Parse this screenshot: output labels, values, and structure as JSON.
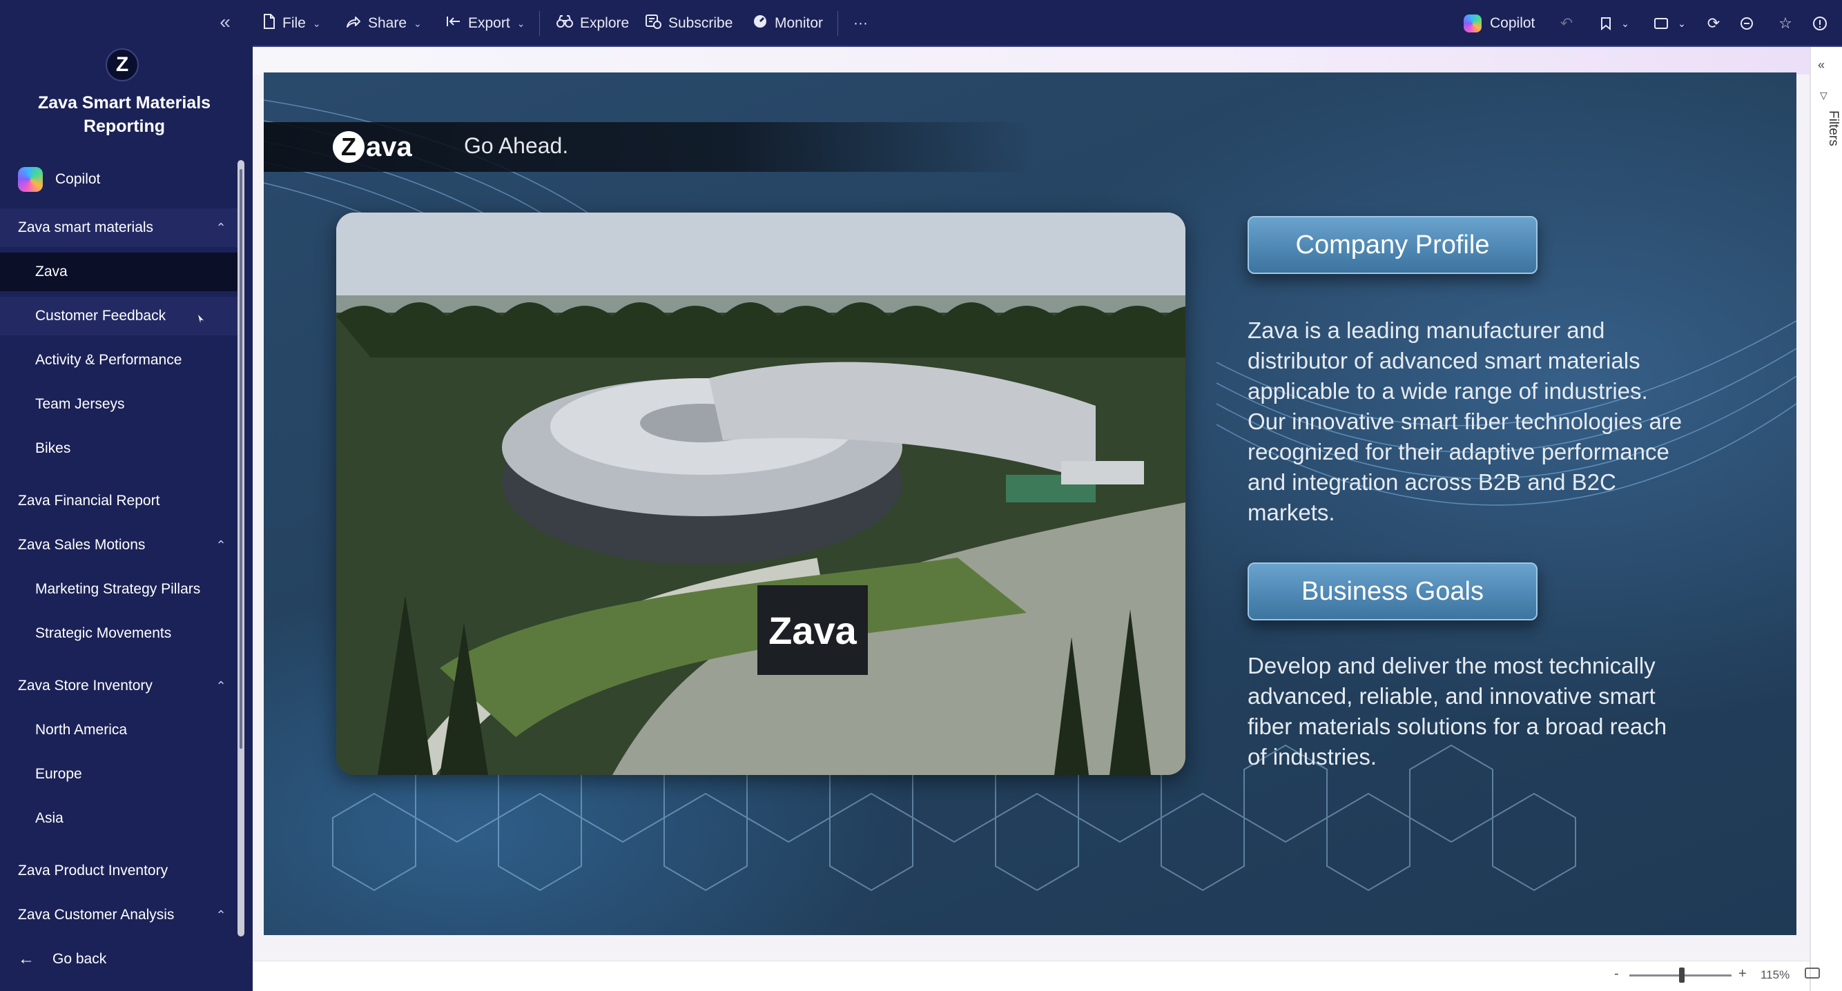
{
  "app": {
    "logo_letter": "Z",
    "title": "Zava Smart Materials Reporting",
    "collapse_icon": "«"
  },
  "sidebar": {
    "copilot_label": "Copilot",
    "sections": [
      {
        "label": "Zava smart materials",
        "expanded": true,
        "children": [
          "Zava",
          "Customer Feedback",
          "Activity & Performance",
          "Team Jerseys",
          "Bikes"
        ]
      },
      {
        "label": "Zava Financial Report"
      },
      {
        "label": "Zava Sales Motions",
        "expanded": true,
        "children": [
          "Marketing Strategy Pillars",
          "Strategic Movements"
        ]
      },
      {
        "label": "Zava Store Inventory",
        "expanded": true,
        "children": [
          "North America",
          "Europe",
          "Asia"
        ]
      },
      {
        "label": "Zava Product Inventory"
      },
      {
        "label": "Zava Customer Analysis",
        "expanded": true
      }
    ],
    "selected_item": "Zava",
    "go_back_label": "Go back"
  },
  "toolbar": {
    "file": "File",
    "share": "Share",
    "export": "Export",
    "explore": "Explore",
    "subscribe": "Subscribe",
    "monitor": "Monitor",
    "more": "···",
    "copilot": "Copilot",
    "icons": [
      "undo-icon",
      "bookmark-icon",
      "view-icon",
      "refresh-icon",
      "comment-icon",
      "favorite-icon",
      "info-icon"
    ]
  },
  "filters": {
    "label": "Filters"
  },
  "slide": {
    "brand_z": "Z",
    "brand_rest": "ava",
    "tagline": "Go Ahead.",
    "sign_text": "Zava",
    "company_profile_heading": "Company Profile",
    "company_profile_text": "Zava is a leading manufacturer and distributor of advanced smart materials applicable to a wide range of industries. Our innovative smart fiber technologies are recognized for their adaptive performance and integration across B2B and B2C markets.",
    "business_goals_heading": "Business Goals",
    "business_goals_text": "Develop and deliver the most technically advanced, reliable, and innovative smart fiber materials solutions for a broad reach of industries."
  },
  "status": {
    "zoom_minus": "-",
    "zoom_plus": "+",
    "zoom_value": "115%",
    "zoom_level": 1.15
  },
  "colors": {
    "sidebar_bg": "#1b2257",
    "selected_bg": "#0b0f28",
    "slide_bg": "#24425f",
    "pill": "#4f88b4"
  }
}
